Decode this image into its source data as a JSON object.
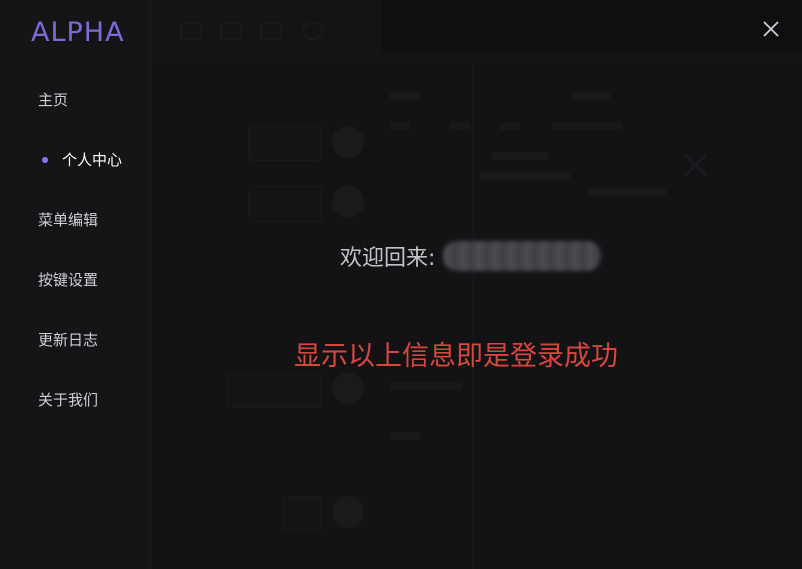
{
  "app": {
    "logo": "ALPHA"
  },
  "sidebar": {
    "items": [
      {
        "label": "主页",
        "active": false
      },
      {
        "label": "个人中心",
        "active": true
      },
      {
        "label": "菜单编辑",
        "active": false
      },
      {
        "label": "按键设置",
        "active": false
      },
      {
        "label": "更新日志",
        "active": false
      },
      {
        "label": "关于我们",
        "active": false
      }
    ]
  },
  "main": {
    "welcome_label": "欢迎回来:",
    "success_message": "显示以上信息即是登录成功"
  },
  "icons": {
    "close": "close-icon",
    "active_indicator": "dot-indicator"
  },
  "colors": {
    "accent": "#7b6bd6",
    "success_text": "#d6483e",
    "background": "#141417"
  }
}
